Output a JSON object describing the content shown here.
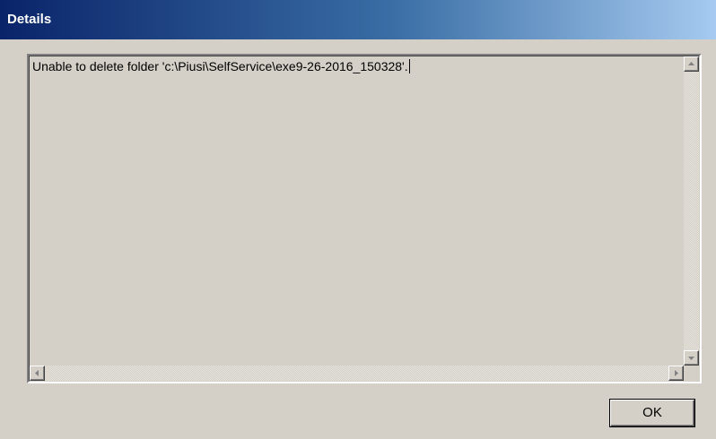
{
  "window": {
    "title": "Details"
  },
  "details": {
    "message": "Unable to delete folder 'c:\\Piusi\\SelfService\\exe9-26-2016_150328'."
  },
  "buttons": {
    "ok_label": "OK"
  },
  "icons": {
    "scroll_up": "triangle-up-icon",
    "scroll_down": "triangle-down-icon",
    "scroll_left": "triangle-left-icon",
    "scroll_right": "triangle-right-icon"
  },
  "colors": {
    "title_start": "#0a246a",
    "title_end": "#a6caf0",
    "face": "#d4d0c8"
  }
}
